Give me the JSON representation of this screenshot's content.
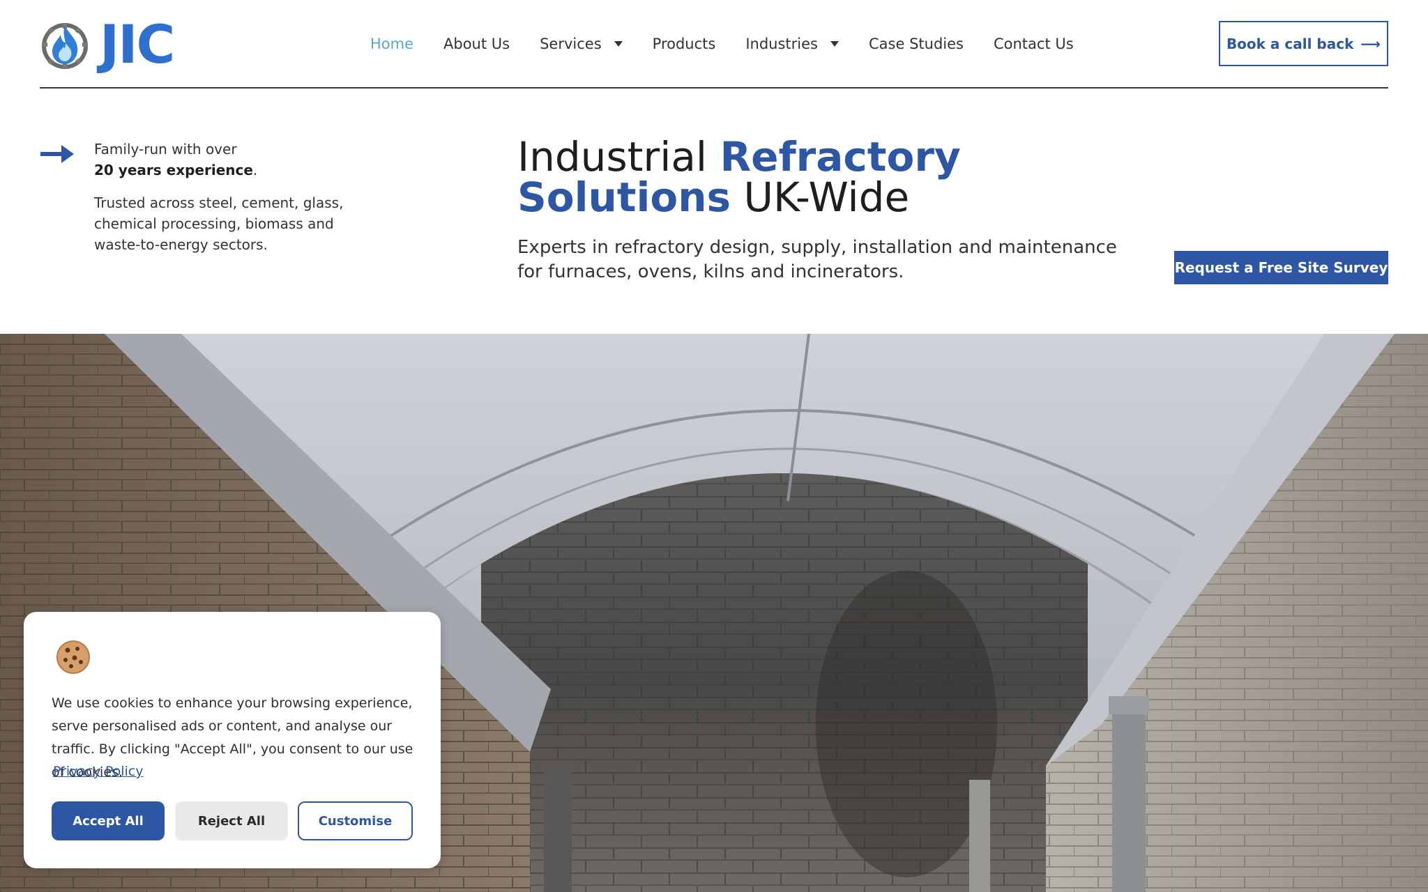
{
  "brand": {
    "name": "JIC",
    "accent": "#2d57a5",
    "logo_blue": "#2f6fd0"
  },
  "nav": {
    "items": [
      {
        "label": "Home",
        "active": true,
        "dropdown": false
      },
      {
        "label": "About Us",
        "active": false,
        "dropdown": false
      },
      {
        "label": "Services",
        "active": false,
        "dropdown": true
      },
      {
        "label": "Products",
        "active": false,
        "dropdown": false
      },
      {
        "label": "Industries",
        "active": false,
        "dropdown": true
      },
      {
        "label": "Case Studies",
        "active": false,
        "dropdown": false
      },
      {
        "label": "Contact Us",
        "active": false,
        "dropdown": false
      }
    ],
    "cta_label": "Book a call back",
    "cta_icon": "arrow-right-icon"
  },
  "hero": {
    "fact_lead": "Family-run with over",
    "fact_bold": "20 years experience",
    "fact_end": ".",
    "fact_secondary": "Trusted across steel, cement, glass, chemical processing, biomass and waste-to-energy sectors.",
    "headline_part1": "Industrial ",
    "headline_highlight1": "Refractory",
    "headline_highlight2": "Solutions",
    "headline_part2": " UK-Wide",
    "subline": "Experts in refractory design, supply, installation and maintenance for furnaces, ovens, kilns and incinerators.",
    "survey_button": "Request a Free Site Survey"
  },
  "cookie_banner": {
    "icon": "cookie-icon",
    "text": "We use cookies to enhance your browsing experience, serve personalised ads or content, and analyse our traffic. By clicking \"Accept All\", you consent to our use of cookies.",
    "privacy_link": "Privacy Policy",
    "accept": "Accept All",
    "reject": "Reject All",
    "customise": "Customise"
  }
}
